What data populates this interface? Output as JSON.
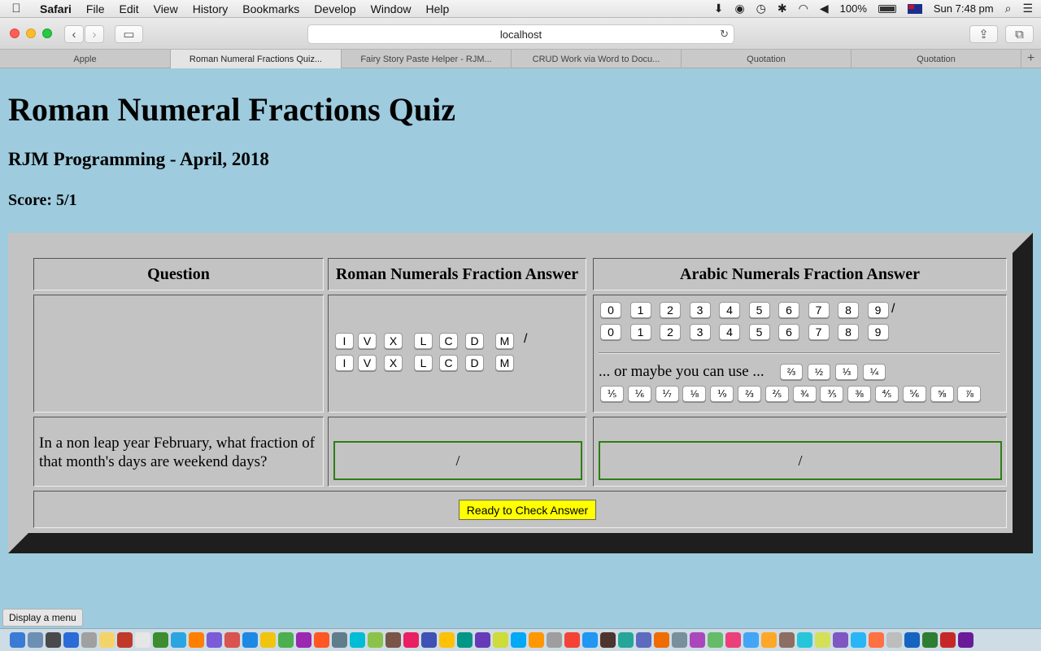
{
  "menubar": {
    "apple": "",
    "items": [
      "Safari",
      "File",
      "Edit",
      "View",
      "History",
      "Bookmarks",
      "Develop",
      "Window",
      "Help"
    ],
    "battery": "100%",
    "clock": "Sun 7:48 pm"
  },
  "toolbar": {
    "url": "localhost"
  },
  "tabs": [
    {
      "label": "Apple"
    },
    {
      "label": "Roman Numeral Fractions Quiz..."
    },
    {
      "label": "Fairy Story Paste Helper - RJM..."
    },
    {
      "label": "CRUD Work via Word to Docu..."
    },
    {
      "label": "Quotation"
    },
    {
      "label": "Quotation"
    }
  ],
  "page": {
    "title": "Roman Numeral Fractions Quiz",
    "subtitle": "RJM Programming - April, 2018",
    "score": "Score: 5/1"
  },
  "quiz": {
    "headers": {
      "question": "Question",
      "roman": "Roman Numerals Fraction Answer",
      "arabic": "Arabic Numerals Fraction Answer"
    },
    "slash": "/",
    "roman_numerator_keys": [
      "I",
      "V",
      "X",
      "L",
      "C",
      "D",
      "M"
    ],
    "roman_denominator_keys": [
      "I",
      "V",
      "X",
      "L",
      "C",
      "D",
      "M"
    ],
    "arabic_numerator_keys": [
      "0",
      "1",
      "2",
      "3",
      "4",
      "5",
      "6",
      "7",
      "8",
      "9"
    ],
    "arabic_denominator_keys": [
      "0",
      "1",
      "2",
      "3",
      "4",
      "5",
      "6",
      "7",
      "8",
      "9"
    ],
    "or_text": "... or maybe you can use ...",
    "fraction_keys_row1": [
      "⅔",
      "½",
      "⅓",
      "¼"
    ],
    "fraction_keys_row2": [
      "⅕",
      "⅙",
      "⅐",
      "⅛",
      "⅑",
      "⅔",
      "⅖",
      "¾",
      "⅗",
      "⅜",
      "⅘",
      "⅚",
      "⅝",
      "⅞"
    ],
    "question_text": "In a non leap year February, what fraction of that month's days are weekend days?",
    "roman_answer_value": "/",
    "arabic_answer_value": "/",
    "check_button": "Ready to Check Answer"
  },
  "status_tooltip": "Display a menu"
}
